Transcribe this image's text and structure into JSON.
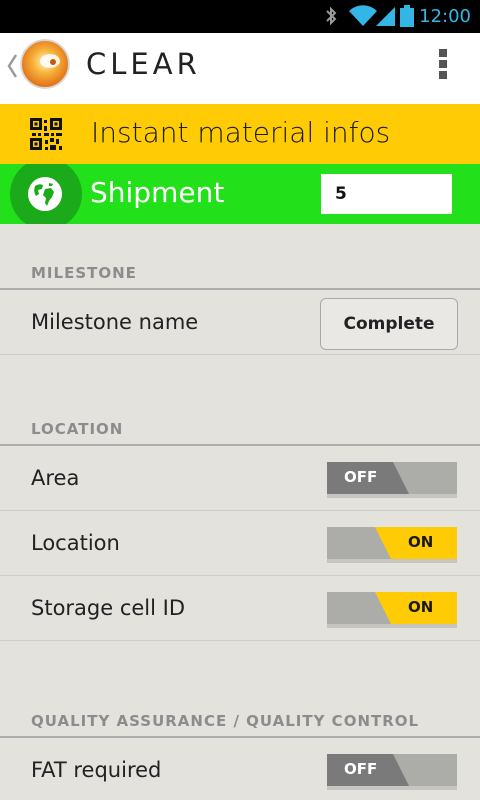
{
  "status_bar": {
    "time": "12:00",
    "icons": [
      "bluetooth-icon",
      "wifi-icon",
      "signal-icon",
      "battery-icon"
    ],
    "accent": "#33b5e5"
  },
  "action_bar": {
    "title": "CLEAR",
    "icons": [
      "back-chevron-icon",
      "app-logo",
      "overflow-menu-icon"
    ]
  },
  "banners": {
    "material": {
      "label": "Instant material infos",
      "icon": "qr-code-icon",
      "color": "#ffcb05"
    },
    "shipment": {
      "label": "Shipment",
      "icon": "globe-icon",
      "value": "5",
      "color": "#22e11b"
    }
  },
  "sections": {
    "milestone": {
      "header": "MILESTONE",
      "rows": [
        {
          "label": "Milestone name",
          "button": "Complete"
        }
      ]
    },
    "location": {
      "header": "LOCATION",
      "rows": [
        {
          "label": "Area",
          "toggle": "OFF"
        },
        {
          "label": "Location",
          "toggle": "ON"
        },
        {
          "label": "Storage cell ID",
          "toggle": "ON"
        }
      ]
    },
    "qa_qc": {
      "header": "QUALITY ASSURANCE / QUALITY CONTROL",
      "rows": [
        {
          "label": "FAT required",
          "toggle": "OFF"
        }
      ]
    }
  },
  "toggle_colors": {
    "on": "#ffcb05",
    "off": "#7a7a7a",
    "track": "#acaca8"
  }
}
